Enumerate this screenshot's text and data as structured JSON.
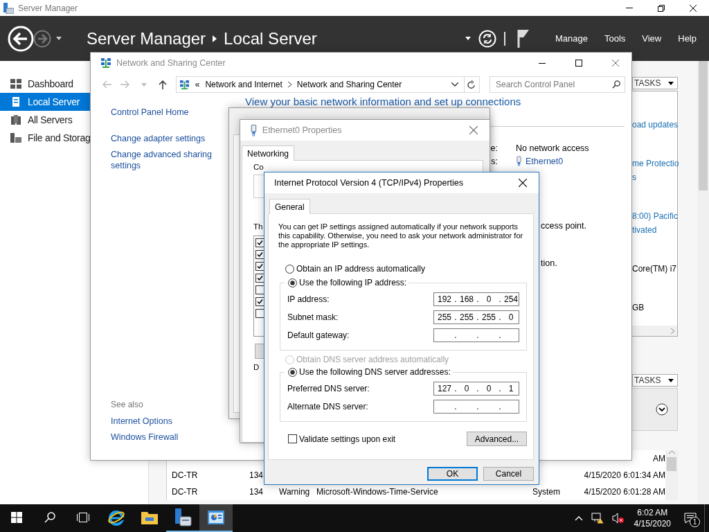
{
  "server_manager": {
    "title": "Server Manager",
    "breadcrumb": [
      {
        "label": "Server Manager"
      },
      {
        "label": "Local Server"
      }
    ],
    "menu": [
      {
        "label": "Manage"
      },
      {
        "label": "Tools"
      },
      {
        "label": "View"
      },
      {
        "label": "Help"
      }
    ],
    "nav": [
      {
        "label": "Dashboard",
        "kind": "dashboard",
        "selected": false
      },
      {
        "label": "Local Server",
        "kind": "server",
        "selected": true
      },
      {
        "label": "All Servers",
        "kind": "servers",
        "selected": false
      },
      {
        "label": "File and Storag",
        "kind": "storage",
        "selected": false
      }
    ],
    "properties": {
      "tasks_label": "TASKS",
      "sections": [
        [
          {
            "text": "oad updates",
            "kind": "link"
          }
        ],
        [
          {
            "text": "me Protectio",
            "kind": "link"
          },
          {
            "text": "s",
            "kind": "link"
          }
        ],
        [
          {
            "text": "8:00) Pacific",
            "kind": "link"
          },
          {
            "text": "tivated",
            "kind": "link"
          }
        ],
        [
          {
            "text": "Core(TM) i7",
            "kind": "text"
          }
        ],
        [
          {
            "text": "GB",
            "kind": "text"
          }
        ]
      ]
    },
    "events": {
      "tasks_label": "TASKS",
      "rows": [
        {
          "time": "AM"
        },
        {
          "server": "DC-TR",
          "id": "134",
          "time": "4/15/2020 6:01:34 AM"
        },
        {
          "server": "DC-TR",
          "id": "134",
          "severity": "Warning",
          "source": "Microsoft-Windows-Time-Service",
          "log": "System",
          "time": "4/15/2020 6:01:28 AM"
        }
      ]
    }
  },
  "network_center": {
    "title": "Network and Sharing Center",
    "breadcrumb_overflow": "«",
    "address": [
      {
        "label": "Network and Internet"
      },
      {
        "label": "Network and Sharing Center"
      }
    ],
    "search_placeholder": "Search Control Panel",
    "sidebar_links": [
      {
        "label": "Control Panel Home"
      },
      {
        "label": "Change adapter settings"
      },
      {
        "label": "Change advanced sharing settings"
      }
    ],
    "see_also_title": "See also",
    "see_also_links": [
      {
        "label": "Internet Options"
      },
      {
        "label": "Windows Firewall"
      }
    ],
    "heading": "View your basic network information and set up connections",
    "access_label": "e:",
    "access_value": "No network access",
    "connections_label": "s:",
    "connection_link": "Ethernet0",
    "fragments": [
      {
        "text": "ccess point."
      },
      {
        "text": "tion."
      }
    ]
  },
  "ethernet_properties": {
    "title": "Ethernet0 Properties",
    "tabs": [
      {
        "label": "Networking",
        "selected": true
      }
    ],
    "connect_label": "Co",
    "items_label": "Th",
    "components": [
      {
        "checked": true
      },
      {
        "checked": true
      },
      {
        "checked": true
      },
      {
        "checked": true
      },
      {
        "checked": false
      },
      {
        "checked": true
      },
      {
        "checked": false
      }
    ],
    "description_label": "D"
  },
  "ipv4_dialog": {
    "title": "Internet Protocol Version 4 (TCP/IPv4) Properties",
    "tabs": [
      {
        "label": "General",
        "selected": true
      }
    ],
    "intro": "You can get IP settings assigned automatically if your network supports this capability. Otherwise, you need to ask your network administrator for the appropriate IP settings.",
    "ip_modes": [
      {
        "label": "Obtain an IP address automatically",
        "selected": false,
        "disabled": false
      },
      {
        "label": "Use the following IP address:",
        "selected": true,
        "disabled": false
      }
    ],
    "ip_fields": [
      {
        "label": "IP address:",
        "octets": [
          "192",
          "168",
          "0",
          "254"
        ],
        "separators": [
          ".",
          ".",
          "."
        ]
      },
      {
        "label": "Subnet mask:",
        "octets": [
          "255",
          "255",
          "255",
          "0"
        ],
        "separators": [
          ".",
          ".",
          "."
        ]
      },
      {
        "label": "Default gateway:",
        "separators": [
          ".",
          ".",
          "."
        ]
      }
    ],
    "dns_modes": [
      {
        "label": "Obtain DNS server address automatically",
        "selected": false,
        "disabled": true
      },
      {
        "label": "Use the following DNS server addresses:",
        "selected": true,
        "disabled": false
      }
    ],
    "dns_fields": [
      {
        "label": "Preferred DNS server:",
        "octets": [
          "127",
          "0",
          "0",
          "1"
        ],
        "separators": [
          ".",
          ".",
          "."
        ]
      },
      {
        "label": "Alternate DNS server:",
        "separators": [
          ".",
          ".",
          "."
        ]
      }
    ],
    "validate": {
      "label": "Validate settings upon exit",
      "checked": false
    },
    "advanced_button": "Advanced...",
    "buttons": [
      {
        "label": "OK",
        "kind": "default"
      },
      {
        "label": "Cancel",
        "kind": "normal"
      }
    ]
  },
  "taskbar": {
    "apps": [
      {
        "kind": "ie",
        "selected": false,
        "running": false
      },
      {
        "kind": "explorer",
        "selected": false,
        "running": false
      },
      {
        "kind": "server-manager",
        "selected": false,
        "running": true
      },
      {
        "kind": "control-panel",
        "selected": true,
        "running": true
      }
    ],
    "time": "6:02 AM",
    "date": "4/15/2020",
    "notification_count": "1"
  }
}
